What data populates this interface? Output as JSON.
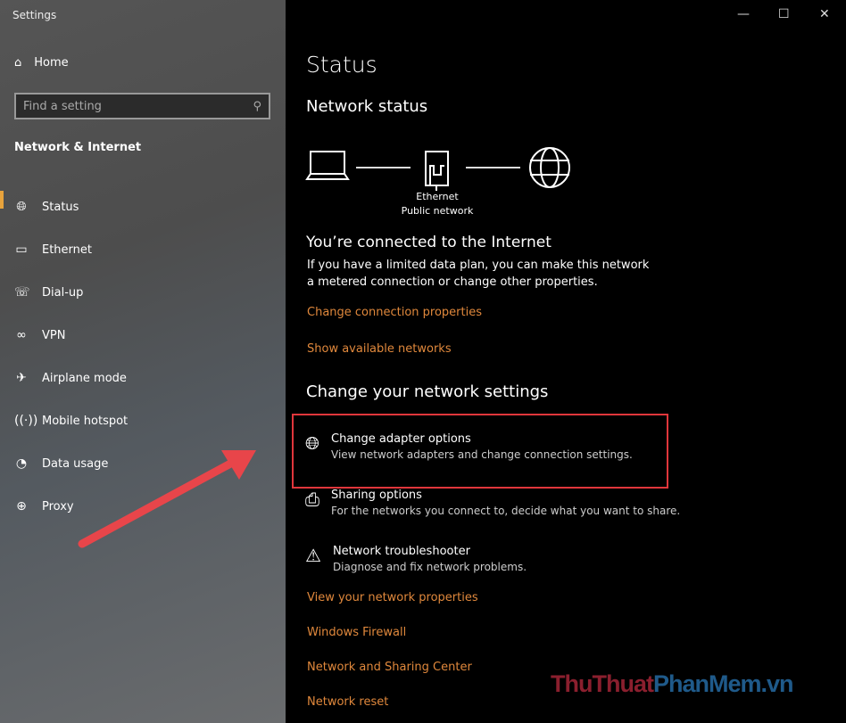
{
  "window": {
    "title": "Settings",
    "minimize": "—",
    "maximize": "☐",
    "close": "✕"
  },
  "sidebar": {
    "home": "Home",
    "search_placeholder": "Find a setting",
    "category": "Network & Internet",
    "items": [
      {
        "label": "Status",
        "icon": "globe-monitor-icon"
      },
      {
        "label": "Ethernet",
        "icon": "ethernet-icon"
      },
      {
        "label": "Dial-up",
        "icon": "dialup-icon"
      },
      {
        "label": "VPN",
        "icon": "vpn-icon"
      },
      {
        "label": "Airplane mode",
        "icon": "airplane-icon"
      },
      {
        "label": "Mobile hotspot",
        "icon": "hotspot-icon"
      },
      {
        "label": "Data usage",
        "icon": "pie-icon"
      },
      {
        "label": "Proxy",
        "icon": "globe-icon"
      }
    ],
    "selected": "Status",
    "accent": "#e8a33c"
  },
  "main": {
    "title": "Status",
    "network_status": "Network status",
    "adapter": "Ethernet",
    "network_type": "Public network",
    "connected_heading": "You’re connected to the Internet",
    "connected_text": "If you have a limited data plan, you can make this network a metered connection or change other properties.",
    "link_change_conn": "Change connection properties",
    "link_show_networks": "Show available networks",
    "change_heading": "Change your network settings",
    "options": [
      {
        "title": "Change adapter options",
        "desc": "View network adapters and change connection settings."
      },
      {
        "title": "Sharing options",
        "desc": "For the networks you connect to, decide what you want to share."
      },
      {
        "title": "Network troubleshooter",
        "desc": "Diagnose and fix network problems."
      }
    ],
    "links": [
      "View your network properties",
      "Windows Firewall",
      "Network and Sharing Center",
      "Network reset"
    ],
    "link_color": "#e0883c",
    "highlight_color": "#e0363b"
  },
  "watermark": {
    "part1": "ThuThuat",
    "part2": "PhanMem",
    "part3": ".vn"
  }
}
